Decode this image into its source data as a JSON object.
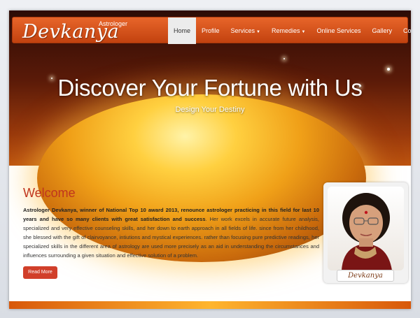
{
  "brand": {
    "small_label": "Astrologer",
    "name": "Devkanya"
  },
  "nav": {
    "items": [
      {
        "label": "Home"
      },
      {
        "label": "Profile"
      },
      {
        "label": "Services"
      },
      {
        "label": "Remedies"
      },
      {
        "label": "Online Services"
      },
      {
        "label": "Gallery"
      },
      {
        "label": "Contacts"
      }
    ]
  },
  "hero": {
    "title": "Discover Your Fortune with Us",
    "subtitle": "Design Your Destiny"
  },
  "welcome": {
    "heading": "Welcome",
    "bold_text": "Astrologer Devkanya, winner of National Top 10 award 2013, renounce astrologer practicing in this field for last 10 years and have so many clients with great satisfaction and success",
    "body_text": ". Her work excels in accurate future analysis, specialized and very effective counseling skills, and her down to earth approach in all fields of life. since from her childhood, she blessed with the gift of clairvoyance, intiutions and mystical experiences. rather than focusing pure predictive readings, her specialized skills in the different area of astrology are used more precisely as an aid in understanding the circumstances and influences surrounding a given situation and effective solution of a problem.",
    "read_more_label": "Read More"
  },
  "profile": {
    "caption": "Devkanya"
  },
  "colors": {
    "accent": "#d9501c",
    "heading": "#c0351e",
    "button": "#d13f2a"
  }
}
